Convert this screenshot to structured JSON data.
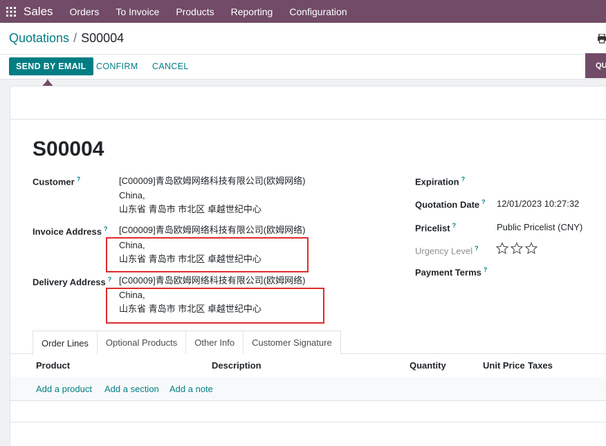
{
  "navbar": {
    "brand": "Sales",
    "menu": [
      "Orders",
      "To Invoice",
      "Products",
      "Reporting",
      "Configuration"
    ]
  },
  "breadcrumb": {
    "parent": "Quotations",
    "separator": "/",
    "current": "S00004"
  },
  "actions": {
    "send_by_email": "SEND BY EMAIL",
    "confirm": "CONFIRM",
    "cancel": "CANCEL",
    "status_partial": "QU"
  },
  "form": {
    "title": "S00004",
    "customer": {
      "label": "Customer",
      "tip": "?",
      "lines": [
        "[C00009]青岛欧姆网络科技有限公司(欧姆网络)",
        "China,",
        "山东省 青岛市 市北区 卓越世纪中心"
      ]
    },
    "invoice_address": {
      "label": "Invoice Address",
      "tip": "?",
      "lines": [
        "[C00009]青岛欧姆网络科技有限公司(欧姆网络)",
        "China,",
        "山东省 青岛市 市北区 卓越世纪中心"
      ]
    },
    "delivery_address": {
      "label": "Delivery Address",
      "tip": "?",
      "lines": [
        "[C00009]青岛欧姆网络科技有限公司(欧姆网络)",
        "China,",
        "山东省 青岛市 市北区 卓越世纪中心"
      ]
    },
    "expiration": {
      "label": "Expiration",
      "tip": "?",
      "value": ""
    },
    "quotation_date": {
      "label": "Quotation Date",
      "tip": "?",
      "value": "12/01/2023 10:27:32"
    },
    "pricelist": {
      "label": "Pricelist",
      "tip": "?",
      "value": "Public Pricelist (CNY)"
    },
    "urgency_level": {
      "label": "Urgency Level",
      "tip": "?",
      "stars": 0,
      "max_stars": 3
    },
    "payment_terms": {
      "label": "Payment Terms",
      "tip": "?",
      "value": ""
    }
  },
  "tabs": [
    "Order Lines",
    "Optional Products",
    "Other Info",
    "Customer Signature"
  ],
  "order_lines": {
    "columns": [
      "Product",
      "Description",
      "Quantity",
      "Unit Price",
      "Taxes"
    ],
    "add_product": "Add a product",
    "add_section": "Add a section",
    "add_note": "Add a note"
  },
  "colors": {
    "navbar": "#714b67",
    "primary": "#017e84",
    "highlight_box": "#e02b2b"
  },
  "icons": [
    "apps-grid-icon",
    "printer-icon",
    "star-icon"
  ]
}
